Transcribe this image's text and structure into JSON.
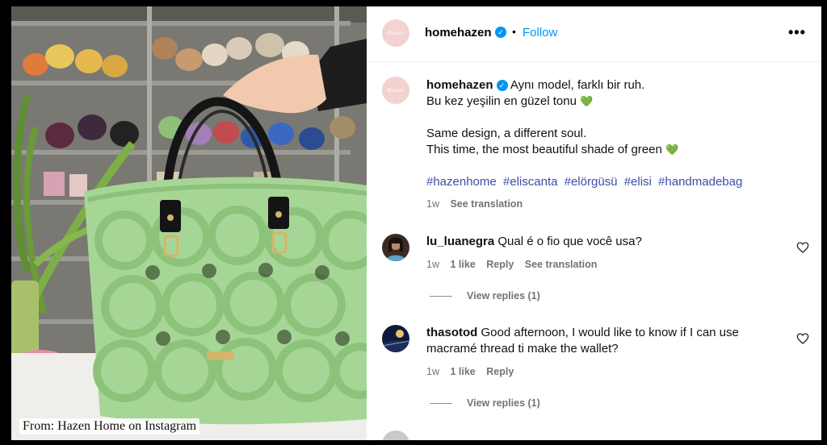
{
  "caption": "From: Hazen Home on Instagram",
  "post": {
    "username": "homehazen",
    "follow_label": "Follow",
    "more_icon": "more-horizontal-icon",
    "avatar_mark": "Hazen",
    "caption_line1": "Aynı model, farklı bir ruh.",
    "caption_line2": "Bu kez yeşilin en güzel tonu",
    "caption_line3": "Same design, a different soul.",
    "caption_line4": "This time, the most beautiful shade of green",
    "green_heart": "💚",
    "hashtags": [
      "#hazenhome",
      "#eliscanta",
      "#elörgüsü",
      "#elisi",
      "#handmadebag"
    ],
    "time": "1w",
    "see_translation": "See translation"
  },
  "comments": [
    {
      "username": "lu_luanegra",
      "text_line1": "Qual é o fio que você usa?",
      "time": "1w",
      "likes": "1 like",
      "reply": "Reply",
      "see_translation": "See translation",
      "view_replies": "View replies (1)"
    },
    {
      "username": "thasotod",
      "text_line1": "Good afternoon, I would like to know if I can use",
      "text_line2": "macramé thread ti make the wallet?",
      "time": "1w",
      "likes": "1 like",
      "reply": "Reply",
      "view_replies": "View replies (1)"
    }
  ],
  "colors": {
    "link_blue": "#0095f6",
    "hashtag": "#3b4fa8",
    "bag_green": "#a6d696",
    "meta_gray": "#737373"
  }
}
